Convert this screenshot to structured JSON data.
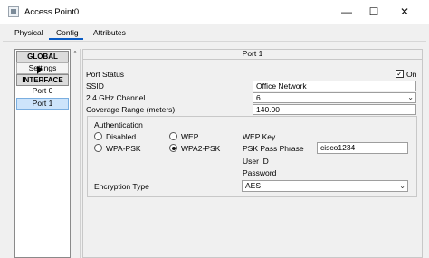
{
  "window": {
    "title": "Access Point0",
    "minimize": "—",
    "maximize": "☐",
    "close": "✕"
  },
  "tabs": [
    {
      "label": "Physical"
    },
    {
      "label": "Config"
    },
    {
      "label": "Attributes"
    }
  ],
  "sidebar": {
    "global_header": "GLOBAL",
    "settings_label": "Settings",
    "interface_header": "INTERFACE",
    "ports": [
      {
        "label": "Port 0"
      },
      {
        "label": "Port 1"
      }
    ],
    "scroll_up": "^"
  },
  "panel": {
    "title": "Port 1",
    "port_status_label": "Port Status",
    "port_status_on_label": "On",
    "port_status_checked": true,
    "ssid_label": "SSID",
    "ssid_value": "Office Network",
    "channel_label": "2.4 GHz Channel",
    "channel_value": "6",
    "coverage_label": "Coverage Range (meters)",
    "coverage_value": "140.00",
    "auth": {
      "title": "Authentication",
      "options": [
        {
          "label": "Disabled"
        },
        {
          "label": "WEP"
        },
        {
          "label": "WPA-PSK"
        },
        {
          "label": "WPA2-PSK"
        }
      ],
      "selected": "WPA2-PSK",
      "wep_key_label": "WEP Key",
      "psk_label": "PSK Pass Phrase",
      "psk_value": "cisco1234",
      "user_id_label": "User ID",
      "password_label": "Password"
    },
    "encryption_label": "Encryption Type",
    "encryption_value": "AES"
  },
  "icons": {
    "dropdown": "chevron-down-icon",
    "check": "checkmark-icon"
  }
}
